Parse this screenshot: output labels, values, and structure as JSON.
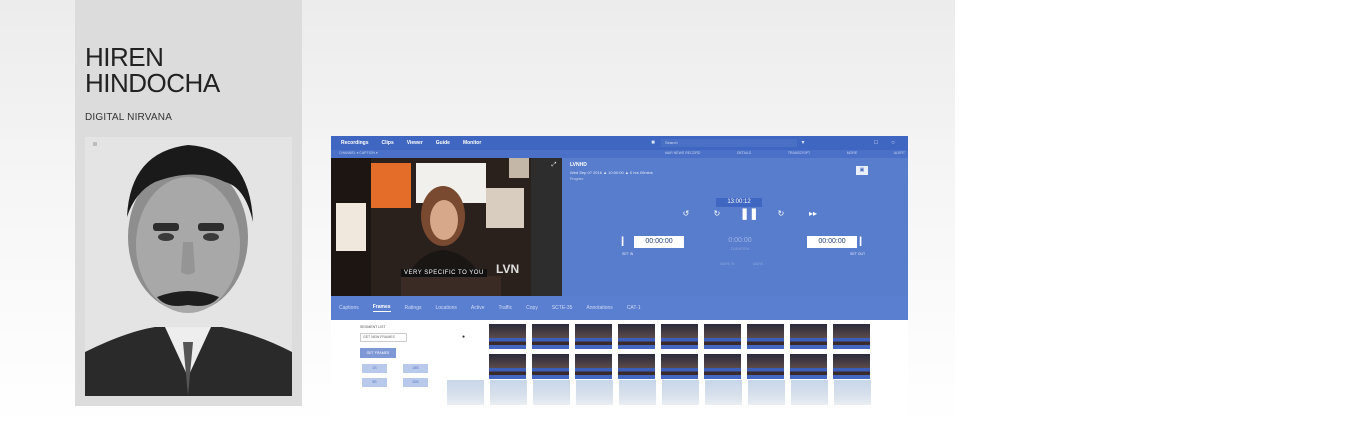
{
  "speaker": {
    "name_line1": "HIREN",
    "name_line2": "HINDOCHA",
    "company": "DIGITAL NIRVANA"
  },
  "app": {
    "nav": [
      "Recordings",
      "Clips",
      "Viewer",
      "Guide",
      "Monitor"
    ],
    "search_placeholder": "Search",
    "subbar_left": "CHANNEL ▾   CAPTION ▾",
    "subbar_cols": [
      "MAR NEWS RECORD",
      "DETAILS",
      "TRANSCRIPT",
      "MORE",
      "ALERT"
    ],
    "player": {
      "caption_text": "VERY SPECIFIC TO YOU",
      "logo_text": "LVN"
    },
    "info": {
      "title": "LVNHD",
      "meta": "Wed Sep 07 2016  ▲ 10:00:00  ▲ 0 hrs 00mins",
      "meta2": "Program"
    },
    "timecode_top": "13:00:12",
    "controls": {
      "rewind": "↺",
      "back": "↻",
      "pause": "❚❚",
      "forward": "↻",
      "fast_forward": "▸▸"
    },
    "set_in_time": "00:00:00",
    "set_out_time": "00:00:00",
    "mid_time": "0:00:00",
    "mid_sub": "DURATION",
    "set_in_label": "SET IN",
    "set_out_label": "SET OUT",
    "mini_labels": [
      "MARK IN",
      "MARK"
    ],
    "tabs": [
      "Captions",
      "Frames",
      "Ratings",
      "Locations",
      "Active",
      "Traffic",
      "Copy",
      "SCTE-35",
      "Annotations",
      "CAT-1"
    ],
    "active_tab": "Frames",
    "panel": {
      "label": "SEGMENT LIST",
      "field_value": "GET NEW FRAMES",
      "main_button": "GET FRAMES",
      "small_buttons": [
        "1S",
        "15S",
        "5S",
        "20S"
      ],
      "bullet": "●"
    }
  }
}
